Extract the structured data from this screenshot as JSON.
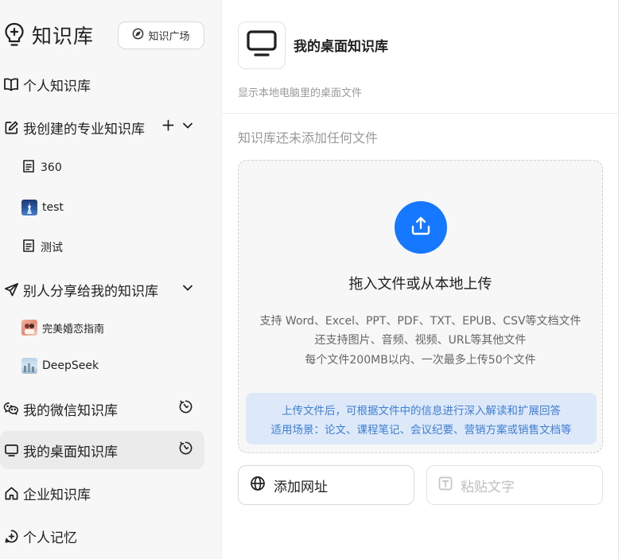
{
  "sidebar": {
    "brand_title": "知识库",
    "plaza_button": "知识广场",
    "items": [
      {
        "label": "个人知识库"
      },
      {
        "label": "我创建的专业知识库"
      },
      {
        "label": "别人分享给我的知识库"
      },
      {
        "label": "我的微信知识库"
      },
      {
        "label": "我的桌面知识库"
      },
      {
        "label": "企业知识库"
      },
      {
        "label": "个人记忆"
      }
    ],
    "created_subitems": [
      {
        "label": "360"
      },
      {
        "label": "test"
      },
      {
        "label": "测试"
      }
    ],
    "shared_subitems": [
      {
        "label": "完美婚恋指南"
      },
      {
        "label": "DeepSeek"
      }
    ]
  },
  "main": {
    "title": "我的桌面知识库",
    "description": "显示本地电脑里的桌面文件",
    "empty_tip": "知识库还未添加任何文件",
    "dropzone": {
      "title": "拖入文件或从本地上传",
      "line1": "支持 Word、Excel、PPT、PDF、TXT、EPUB、CSV等文档文件",
      "line2": "还支持图片、音频、视频、URL等其他文件",
      "line3": "每个文件200MB以内、一次最多上传50个文件",
      "info1": "上传文件后，可根据文件中的信息进行深入解读和扩展回答",
      "info2": "适用场景：论文、课程笔记、会议纪要、营销方案或销售文档等"
    },
    "add_url_button": "添加网址",
    "paste_text_button": "粘贴文字"
  },
  "colors": {
    "accent": "#1677ff",
    "info_bg": "#dde8f8",
    "info_text": "#3f7fd6",
    "sidebar_bg": "#f7f7f7",
    "active_item_bg": "#ebebeb"
  }
}
